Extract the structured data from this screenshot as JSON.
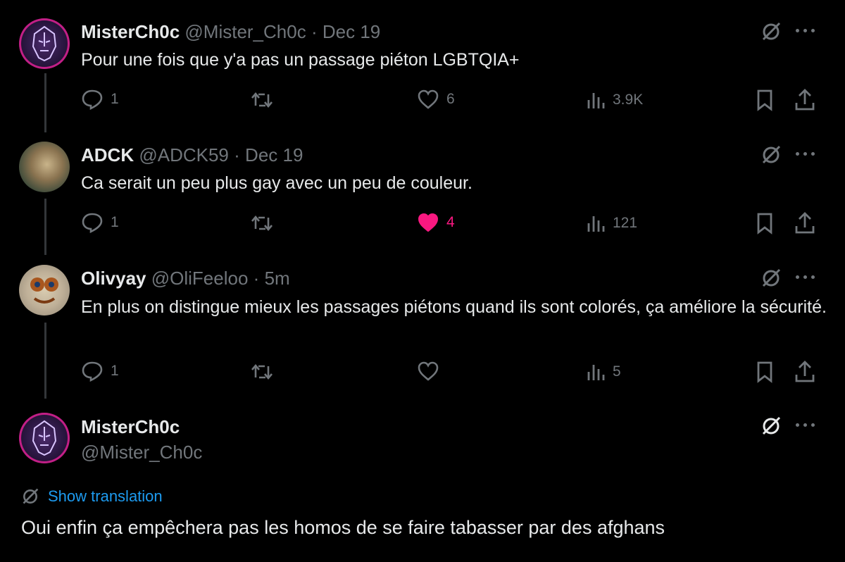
{
  "tweets": [
    {
      "display_name": "MisterCh0c",
      "handle": "@Mister_Ch0c",
      "date": "Dec 19",
      "text": "Pour une fois que y'a pas un passage piéton LGBTQIA+",
      "replies": "1",
      "reposts": "",
      "likes": "6",
      "views": "3.9K",
      "liked": false
    },
    {
      "display_name": "ADCK",
      "handle": "@ADCK59",
      "date": "Dec 19",
      "text": "Ca serait un peu plus gay avec un peu de couleur.",
      "replies": "1",
      "reposts": "",
      "likes": "4",
      "views": "121",
      "liked": true
    },
    {
      "display_name": "Olivyay",
      "handle": "@OliFeeloo",
      "date": "5m",
      "text": "En plus on distingue mieux les passages piétons quand ils sont colorés, ça améliore la sécurité.",
      "replies": "1",
      "reposts": "",
      "likes": "",
      "views": "5",
      "liked": false
    }
  ],
  "main_tweet": {
    "display_name": "MisterCh0c",
    "handle": "@Mister_Ch0c",
    "show_translation": "Show translation",
    "text": "Oui enfin ça empêchera pas les homos de se faire tabasser par des afghans"
  },
  "colors": {
    "background": "#000000",
    "text": "#e7e9ea",
    "muted": "#71767b",
    "like": "#f91880",
    "link": "#1d9bf0"
  },
  "icons": [
    "grok-icon",
    "more-icon",
    "reply-icon",
    "repost-icon",
    "like-icon",
    "views-icon",
    "bookmark-icon",
    "share-icon",
    "translate-icon"
  ]
}
